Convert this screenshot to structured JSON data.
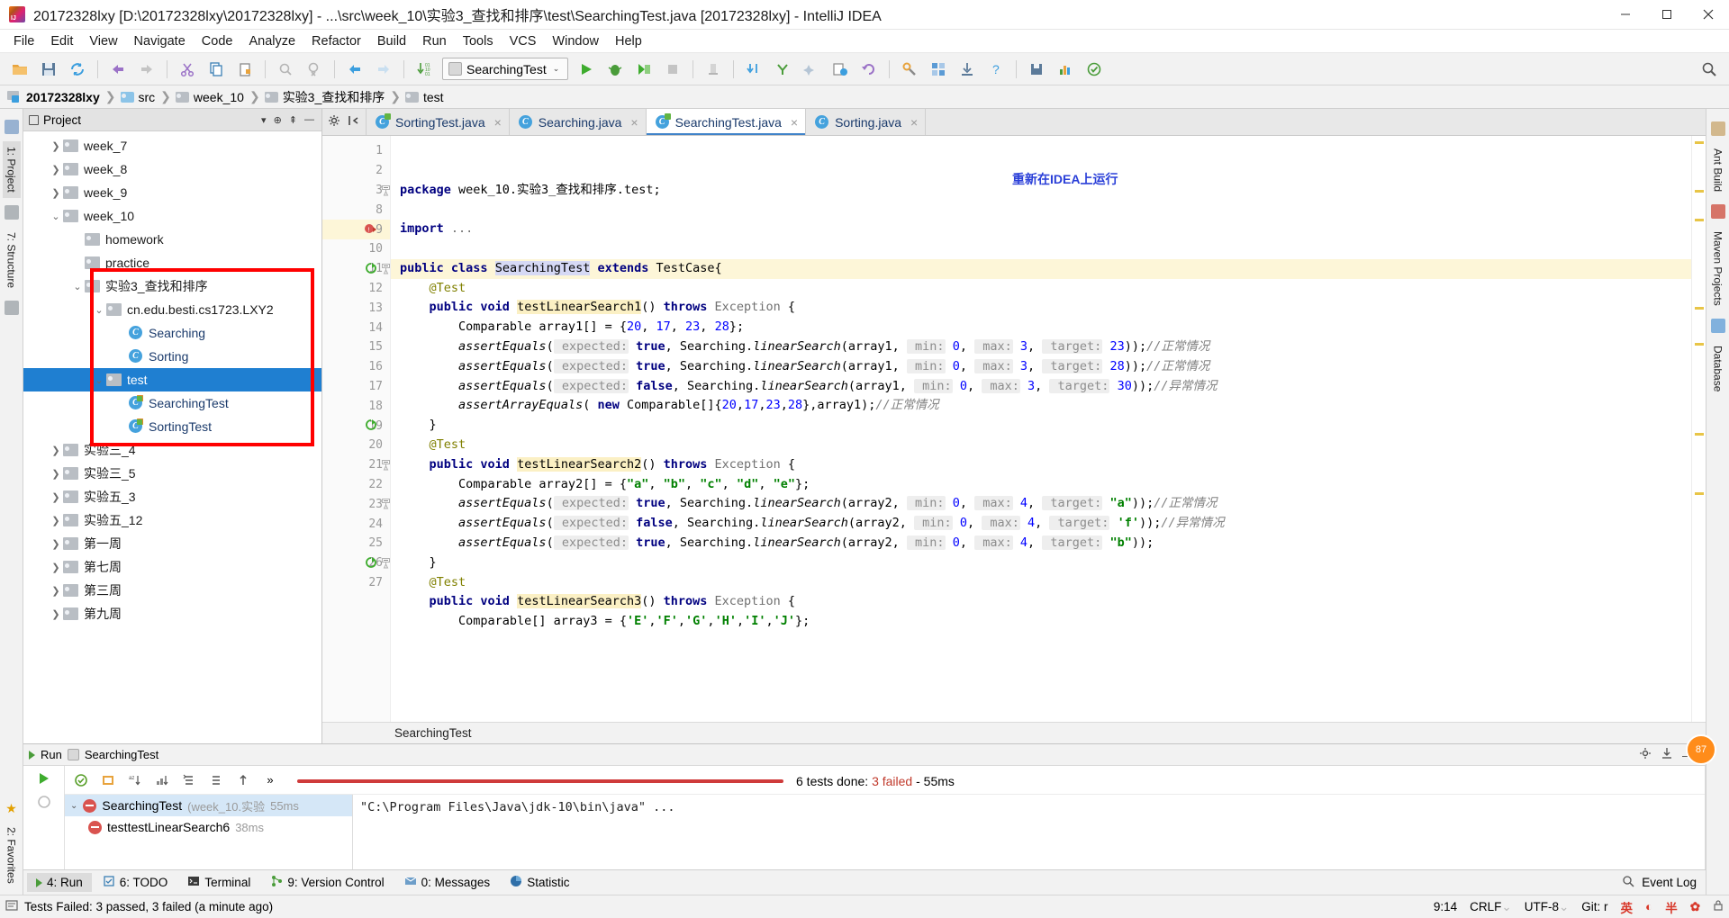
{
  "window": {
    "title": "20172328lxy [D:\\20172328lxy\\20172328lxy] - ...\\src\\week_10\\实验3_查找和排序\\test\\SearchingTest.java [20172328lxy] - IntelliJ IDEA",
    "minimize": "—",
    "maximize": "❐",
    "close": "✕"
  },
  "menu": [
    {
      "label": "File"
    },
    {
      "label": "Edit"
    },
    {
      "label": "View"
    },
    {
      "label": "Navigate"
    },
    {
      "label": "Code"
    },
    {
      "label": "Analyze"
    },
    {
      "label": "Refactor"
    },
    {
      "label": "Build"
    },
    {
      "label": "Run"
    },
    {
      "label": "Tools"
    },
    {
      "label": "VCS"
    },
    {
      "label": "Window"
    },
    {
      "label": "Help"
    }
  ],
  "toolbar": {
    "run_config": "SearchingTest",
    "caret": "⌄",
    "icons": [
      "open-folder-icon",
      "save-all-icon",
      "sync-icon",
      "undo-icon",
      "redo-icon",
      "cut-icon",
      "copy-icon",
      "paste-icon",
      "find-icon",
      "replace-icon",
      "back-icon",
      "forward-icon",
      "compile-icon"
    ],
    "run_icons": [
      "run-icon",
      "debug-icon",
      "run-coverage-icon",
      "stop-icon",
      "build-icon",
      "step-in-icon",
      "commit-icon",
      "update-icon",
      "history-icon",
      "revert-icon",
      "settings-icon",
      "help-icon"
    ],
    "search_everywhere": "search-everywhere-icon"
  },
  "breadcrumb": [
    {
      "label": "20172328lxy",
      "icon": "project-icon"
    },
    {
      "label": "src",
      "icon": "source-folder-icon"
    },
    {
      "label": "week_10",
      "icon": "folder-icon"
    },
    {
      "label": "实验3_查找和排序",
      "icon": "folder-icon"
    },
    {
      "label": "test",
      "icon": "folder-icon"
    }
  ],
  "left_rail": [
    {
      "label": "1: Project",
      "active": true
    },
    {
      "label": "7: Structure",
      "active": false
    },
    {
      "label": "2: Favorites",
      "active": false
    }
  ],
  "right_rail": [
    {
      "label": "Ant Build"
    },
    {
      "label": "Maven Projects"
    },
    {
      "label": "Database"
    }
  ],
  "project_panel": {
    "title": "Project",
    "actions": [
      "collapse-icon",
      "locate-icon",
      "settings-icon",
      "hide-icon"
    ],
    "tree": [
      {
        "indent": 1,
        "arrow": "›",
        "icon": "folder",
        "label": "week_7",
        "selected": false,
        "blue": false
      },
      {
        "indent": 1,
        "arrow": "›",
        "icon": "folder",
        "label": "week_8",
        "selected": false,
        "blue": false
      },
      {
        "indent": 1,
        "arrow": "›",
        "icon": "folder",
        "label": "week_9",
        "selected": false,
        "blue": false
      },
      {
        "indent": 1,
        "arrow": "⌄",
        "icon": "folder",
        "label": "week_10",
        "selected": false,
        "blue": false
      },
      {
        "indent": 2,
        "arrow": "",
        "icon": "folder",
        "label": "homework",
        "selected": false,
        "blue": false
      },
      {
        "indent": 2,
        "arrow": "",
        "icon": "folder",
        "label": "practice",
        "selected": false,
        "blue": false
      },
      {
        "indent": 2,
        "arrow": "⌄",
        "icon": "folder",
        "label": "实验3_查找和排序",
        "selected": false,
        "blue": false
      },
      {
        "indent": 3,
        "arrow": "⌄",
        "icon": "folder",
        "label": "cn.edu.besti.cs1723.LXY2",
        "selected": false,
        "blue": false
      },
      {
        "indent": 4,
        "arrow": "",
        "icon": "class",
        "label": "Searching",
        "selected": false,
        "blue": true
      },
      {
        "indent": 4,
        "arrow": "",
        "icon": "class",
        "label": "Sorting",
        "selected": false,
        "blue": true
      },
      {
        "indent": 3,
        "arrow": "⌄",
        "icon": "folder",
        "label": "test",
        "selected": true,
        "blue": true
      },
      {
        "indent": 4,
        "arrow": "",
        "icon": "class-test",
        "label": "SearchingTest",
        "selected": false,
        "blue": true
      },
      {
        "indent": 4,
        "arrow": "",
        "icon": "class-test",
        "label": "SortingTest",
        "selected": false,
        "blue": true
      },
      {
        "indent": 1,
        "arrow": "›",
        "icon": "folder",
        "label": "实验三_4",
        "selected": false,
        "blue": false
      },
      {
        "indent": 1,
        "arrow": "›",
        "icon": "folder",
        "label": "实验三_5",
        "selected": false,
        "blue": false
      },
      {
        "indent": 1,
        "arrow": "›",
        "icon": "folder",
        "label": "实验五_3",
        "selected": false,
        "blue": false
      },
      {
        "indent": 1,
        "arrow": "›",
        "icon": "folder",
        "label": "实验五_12",
        "selected": false,
        "blue": false
      },
      {
        "indent": 1,
        "arrow": "›",
        "icon": "folder",
        "label": "第一周",
        "selected": false,
        "blue": false
      },
      {
        "indent": 1,
        "arrow": "›",
        "icon": "folder",
        "label": "第七周",
        "selected": false,
        "blue": false
      },
      {
        "indent": 1,
        "arrow": "›",
        "icon": "folder",
        "label": "第三周",
        "selected": false,
        "blue": false
      },
      {
        "indent": 1,
        "arrow": "›",
        "icon": "folder",
        "label": "第九周",
        "selected": false,
        "blue": false
      }
    ]
  },
  "editor": {
    "tabs": [
      {
        "label": "SortingTest.java",
        "active": false,
        "test": true
      },
      {
        "label": "Searching.java",
        "active": false,
        "test": false
      },
      {
        "label": "SearchingTest.java",
        "active": true,
        "test": true
      },
      {
        "label": "Sorting.java",
        "active": false,
        "test": false
      }
    ],
    "close_glyph": "×",
    "annotation": "重新在IDEA上运行",
    "status_breadcrumb": "SearchingTest",
    "line_numbers": [
      "1",
      "2",
      "3",
      "8",
      "9",
      "10",
      "11",
      "12",
      "13",
      "14",
      "15",
      "16",
      "17",
      "18",
      "19",
      "20",
      "21",
      "22",
      "23",
      "24",
      "25",
      "26",
      "27"
    ]
  },
  "code_lines": [
    {
      "n": "1",
      "html": "<span class='kw'>package</span> week_10.实验3_查找和排序.test;"
    },
    {
      "n": "2",
      "html": ""
    },
    {
      "n": "3",
      "html": "<span class='kw'>import</span> <span class='grey'>...</span>"
    },
    {
      "n": "8",
      "html": ""
    },
    {
      "n": "9",
      "html": "<span class='kw'>public class</span> <span class='selw'>SearchingTest</span> <span class='kw'>extends</span> TestCase{",
      "hl": true
    },
    {
      "n": "10",
      "html": "    <span class='ann'>@Test</span>"
    },
    {
      "n": "11",
      "html": "    <span class='kw'>public void</span> <span class='mtd'>testLinearSearch1</span>() <span class='kw'>throws</span> <span class='grey'>Exception</span> {"
    },
    {
      "n": "12",
      "html": "        Comparable array1[] = {<span class='num'>20</span>, <span class='num'>17</span>, <span class='num'>23</span>, <span class='num'>28</span>};"
    },
    {
      "n": "13",
      "html": "        <span class='ital'>assertEquals</span>(<span class='hint'> expected:</span> <span class='kw'>true</span>, Searching.<span class='ital'>linearSearch</span>(array1, <span class='hint'> min:</span> <span class='num'>0</span>, <span class='hint'> max:</span> <span class='num'>3</span>, <span class='hint'> target:</span> <span class='num'>23</span>));<span class='cmt'>//正常情况</span>"
    },
    {
      "n": "14",
      "html": "        <span class='ital'>assertEquals</span>(<span class='hint'> expected:</span> <span class='kw'>true</span>, Searching.<span class='ital'>linearSearch</span>(array1, <span class='hint'> min:</span> <span class='num'>0</span>, <span class='hint'> max:</span> <span class='num'>3</span>, <span class='hint'> target:</span> <span class='num'>28</span>));<span class='cmt'>//正常情况</span>"
    },
    {
      "n": "15",
      "html": "        <span class='ital'>assertEquals</span>(<span class='hint'> expected:</span> <span class='kw'>false</span>, Searching.<span class='ital'>linearSearch</span>(array1, <span class='hint'> min:</span> <span class='num'>0</span>, <span class='hint'> max:</span> <span class='num'>3</span>, <span class='hint'> target:</span> <span class='num'>30</span>));<span class='cmt'>//异常情况</span>"
    },
    {
      "n": "16",
      "html": "        <span class='ital'>assertArrayEquals</span>( <span class='kw'>new</span> Comparable[]{<span class='num'>20</span>,<span class='num'>17</span>,<span class='num'>23</span>,<span class='num'>28</span>},array1);<span class='cmt'>//正常情况</span>"
    },
    {
      "n": "17",
      "html": "    }"
    },
    {
      "n": "18",
      "html": "    <span class='ann'>@Test</span>"
    },
    {
      "n": "19",
      "html": "    <span class='kw'>public void</span> <span class='mtd'>testLinearSearch2</span>() <span class='kw'>throws</span> <span class='grey'>Exception</span> {"
    },
    {
      "n": "20",
      "html": "        Comparable array2[] = {<span class='str'>\"a\"</span>, <span class='str'>\"b\"</span>, <span class='str'>\"c\"</span>, <span class='str'>\"d\"</span>, <span class='str'>\"e\"</span>};"
    },
    {
      "n": "21",
      "html": "        <span class='ital'>assertEquals</span>(<span class='hint'> expected:</span> <span class='kw'>true</span>, Searching.<span class='ital'>linearSearch</span>(array2, <span class='hint'> min:</span> <span class='num'>0</span>, <span class='hint'> max:</span> <span class='num'>4</span>, <span class='hint'> target:</span> <span class='str'>\"a\"</span>));<span class='cmt'>//正常情况</span>"
    },
    {
      "n": "22",
      "html": "        <span class='ital'>assertEquals</span>(<span class='hint'> expected:</span> <span class='kw'>false</span>, Searching.<span class='ital'>linearSearch</span>(array2, <span class='hint'> min:</span> <span class='num'>0</span>, <span class='hint'> max:</span> <span class='num'>4</span>, <span class='hint'> target:</span> <span class='str'>'f'</span>));<span class='cmt'>//异常情况</span>"
    },
    {
      "n": "23",
      "html": "        <span class='ital'>assertEquals</span>(<span class='hint'> expected:</span> <span class='kw'>true</span>, Searching.<span class='ital'>linearSearch</span>(array2, <span class='hint'> min:</span> <span class='num'>0</span>, <span class='hint'> max:</span> <span class='num'>4</span>, <span class='hint'> target:</span> <span class='str'>\"b\"</span>));"
    },
    {
      "n": "24",
      "html": "    }"
    },
    {
      "n": "25",
      "html": "    <span class='ann'>@Test</span>"
    },
    {
      "n": "26",
      "html": "    <span class='kw'>public void</span> <span class='mtd'>testLinearSearch3</span>() <span class='kw'>throws</span> <span class='grey'>Exception</span> {"
    },
    {
      "n": "27",
      "html": "        Comparable[] array3 = {<span class='str'>'E'</span>,<span class='str'>'F'</span>,<span class='str'>'G'</span>,<span class='str'>'H'</span>,<span class='str'>'I'</span>,<span class='str'>'J'</span>};"
    }
  ],
  "run_panel": {
    "tab_label": "Run",
    "config_name": "SearchingTest",
    "summary": "6 tests done:",
    "failed_text": "3 failed",
    "duration": "- 55ms",
    "tree": [
      {
        "label": "SearchingTest",
        "sub": "(week_10.实验",
        "time": "55ms",
        "status": "fail",
        "selected": true,
        "indent": 0
      },
      {
        "label": "testtestLinearSearch6",
        "sub": "",
        "time": "38ms",
        "status": "fail",
        "selected": false,
        "indent": 1
      }
    ],
    "console_line": "\"C:\\Program Files\\Java\\jdk-10\\bin\\java\" ...",
    "toolbar_icons": [
      "rerun-icon",
      "rerun-failed-icon",
      "toggle-auto-test-icon",
      "sort-icon",
      "filter-icon",
      "expand-all-icon",
      "collapse-all-icon",
      "prev-icon",
      "more-icon"
    ],
    "right_icons": [
      "settings-icon",
      "export-icon"
    ]
  },
  "bottom_bar": {
    "items": [
      {
        "label": "4: Run",
        "icon": "run-icon",
        "active": true
      },
      {
        "label": "6: TODO",
        "icon": "todo-icon",
        "active": false
      },
      {
        "label": "Terminal",
        "icon": "terminal-icon",
        "active": false
      },
      {
        "label": "9: Version Control",
        "icon": "vcs-icon",
        "active": false
      },
      {
        "label": "0: Messages",
        "icon": "messages-icon",
        "active": false
      },
      {
        "label": "Statistic",
        "icon": "statistic-icon",
        "active": false
      }
    ],
    "event_log": "Event Log",
    "event_log_icon": "search-icon"
  },
  "status_bar": {
    "message": "Tests Failed: 3 passed, 3 failed (a minute ago)",
    "icon": "info-icon",
    "caret_pos": "9:14",
    "line_sep": "CRLF",
    "line_sep_caret": "⌄",
    "encoding": "UTF-8",
    "encoding_caret": "⌄",
    "git_branch": "Git: r",
    "ime": [
      "英",
      "◐",
      "半",
      "✿"
    ],
    "lock_icon": "lock-icon"
  },
  "colors": {
    "accent_blue": "#1f7fd1",
    "red_highlight": "#ff0000",
    "fail_red": "#c0392b",
    "annotation_blue": "#2a3fd8",
    "run_green": "#4a9c3a"
  }
}
